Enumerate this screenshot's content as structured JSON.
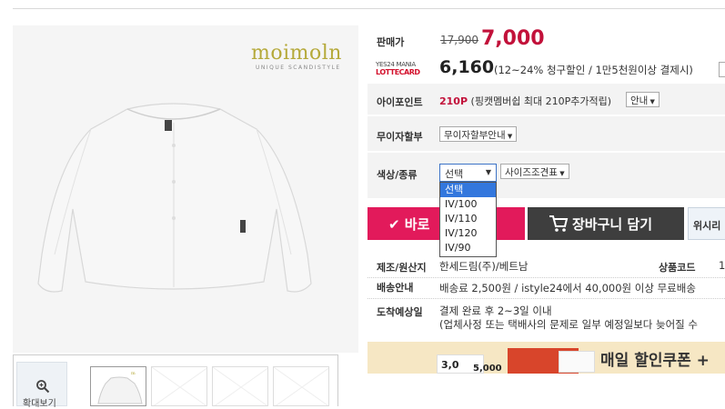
{
  "brand": {
    "logo": "moimoln",
    "tagline": "UNIQUE SCANDISTYLE"
  },
  "gallery": {
    "zoom_label": "확대보기"
  },
  "price": {
    "label": "판매가",
    "original": "17,900",
    "sale": "7,000"
  },
  "card_discount": {
    "logo_top": "YES24 MANIA",
    "logo_bottom": "LOTTECARD",
    "price": "6,160",
    "desc": "(12~24% 청구할인 / 1만5천원이상 결제시)"
  },
  "ipoint": {
    "label": "아이포인트",
    "value": "210P",
    "desc": "(핑캣멤버쉽 최대 210P추가적립)",
    "info_button": "안내"
  },
  "installment": {
    "label": "무이자할부",
    "button": "무이자할부안내"
  },
  "option": {
    "label": "색상/종류",
    "selected": "선택",
    "size_chart_button": "사이즈조견표",
    "options": [
      "선택",
      "IV/100",
      "IV/110",
      "IV/120",
      "IV/90"
    ]
  },
  "actions": {
    "buy": "바로",
    "cart": "장바구니 담기",
    "wish": "위시리"
  },
  "details": {
    "origin_label": "제조/원산지",
    "origin_value": "한세드림(주)/베트남",
    "product_code_label": "상품코드",
    "product_code_value": "1",
    "shipping_label": "배송안내",
    "shipping_value": "배송료 2,500원 / istyle24에서 40,000원 이상 무료배송",
    "arrival_label": "도착예상일",
    "arrival_value": "결제 완료 후 2~3일 이내",
    "arrival_note": "(업체사정 또는 택배사의 문제로 일부 예정일보다 늦어질 수"
  },
  "banner": {
    "text": "매일 할인쿠폰 +",
    "coupon_a": "3,0",
    "coupon_b": "5,000"
  },
  "colors": {
    "accent": "#c2113a",
    "buy": "#e21a5b",
    "cart": "#3e3e3e",
    "select_highlight": "#3377dd"
  }
}
